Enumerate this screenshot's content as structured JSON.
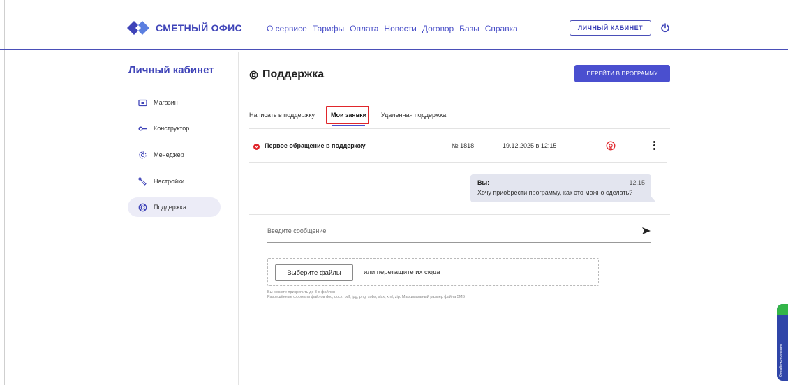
{
  "header": {
    "logo_text": "СМЕТНЫЙ ОФИС",
    "nav": [
      "О сервисе",
      "Тарифы",
      "Оплата",
      "Новости",
      "Договор",
      "Базы",
      "Справка"
    ],
    "cabinet_button": "ЛИЧНЫЙ КАБИНЕТ",
    "power_icon": "power-icon"
  },
  "sidebar": {
    "title": "Личный кабинет",
    "items": [
      {
        "label": "Магазин",
        "icon": "store-icon"
      },
      {
        "label": "Конструктор",
        "icon": "key-icon"
      },
      {
        "label": "Менеджер",
        "icon": "gear-icon"
      },
      {
        "label": "Настройки",
        "icon": "wrench-icon"
      },
      {
        "label": "Поддержка",
        "icon": "lifebuoy-icon",
        "active": true
      }
    ]
  },
  "main": {
    "title": "Поддержка",
    "go_button": "ПЕРЕЙТИ В ПРОГРАММУ",
    "tabs": [
      {
        "label": "Написать в поддержку"
      },
      {
        "label": "Мои заявки",
        "active": true
      },
      {
        "label": "Удаленная поддержка"
      }
    ],
    "ticket": {
      "title": "Первое обращение в поддержку",
      "number": "№ 1818",
      "date": "19.12.2025 в 12:15"
    },
    "message": {
      "author": "Вы:",
      "time": "12.15",
      "text": "Хочу приобрести программу, как это можно сделать?"
    },
    "composer": {
      "placeholder": "Введите сообщение",
      "choose_files": "Выберите файлы",
      "drop_text": "или перетащите их сюда",
      "hint_line1": "Вы можете прикрепить до 3-х файлов",
      "hint_line2": "Разрешённые форматы файлов doc, docx, pdf, jpg, png, sobx, slsx, xml, zip. Максимальный размер файла 5MB"
    }
  },
  "widget": {
    "label": "Онлайн-консультант"
  },
  "colors": {
    "brand": "#3f44b8",
    "button": "#4a4fcf",
    "highlight": "#e0262b",
    "bubble": "#e3e5ef",
    "widget": "#2f45a8"
  }
}
